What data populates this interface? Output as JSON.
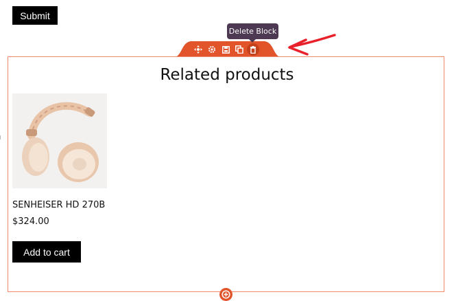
{
  "submit": {
    "label": "Submit"
  },
  "toolbar": {
    "tooltip": "Delete Block",
    "buttons": [
      "move-icon",
      "gear-icon",
      "save-icon",
      "duplicate-icon",
      "trash-icon"
    ]
  },
  "block": {
    "heading": "Related products",
    "product": {
      "name": "SENHEISER HD 270B",
      "price": "$324.00",
      "cta": "Add to cart"
    }
  },
  "colors": {
    "accent": "#e2542a",
    "tooltip_bg": "#4d3a52",
    "arrow": "#e8202a",
    "block_border": "#f0866a"
  }
}
